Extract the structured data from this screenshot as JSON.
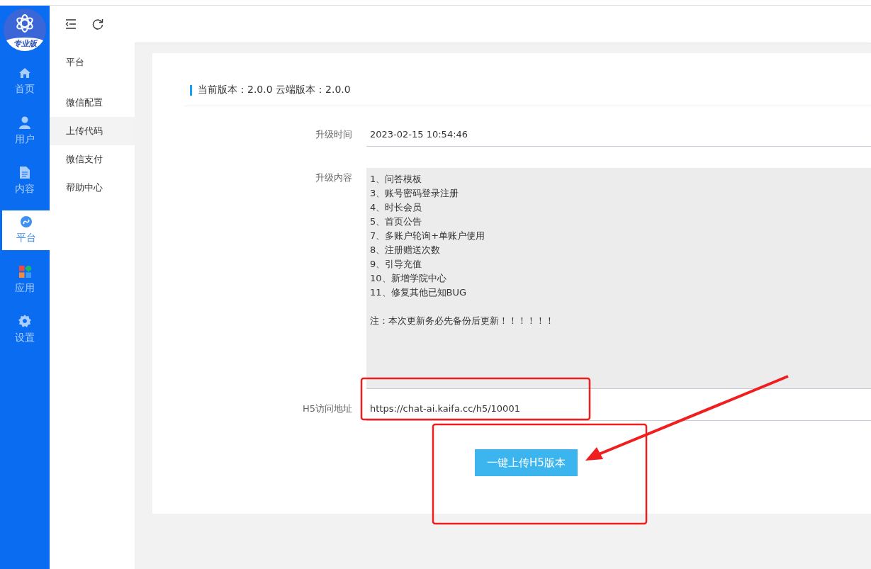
{
  "logo": {
    "badge": "专业版"
  },
  "rail": {
    "items": [
      {
        "label": "首页",
        "selected": false
      },
      {
        "label": "用户",
        "selected": false
      },
      {
        "label": "内容",
        "selected": false
      },
      {
        "label": "平台",
        "selected": true
      },
      {
        "label": "应用",
        "selected": false
      },
      {
        "label": "设置",
        "selected": false
      }
    ]
  },
  "submenu": {
    "title": "平台",
    "items": [
      {
        "label": "微信配置",
        "selected": false
      },
      {
        "label": "上传代码",
        "selected": true
      },
      {
        "label": "微信支付",
        "selected": false
      },
      {
        "label": "帮助中心",
        "selected": false
      }
    ]
  },
  "card": {
    "title": "当前版本：2.0.0 云端版本：2.0.0",
    "fields": [
      {
        "kind": "line",
        "label": "升级时间",
        "value": "2023-02-15 10:54:46"
      },
      {
        "kind": "area",
        "label": "升级内容",
        "value": "1、问答模板\n3、账号密码登录注册\n4、时长会员\n5、首页公告\n7、多账户轮询+单账户使用\n8、注册赠送次数\n9、引导充值\n10、新增学院中心\n11、修复其他已知BUG\n\n注：本次更新务必先备份后更新！！！！！！"
      },
      {
        "kind": "line",
        "label": "H5访问地址",
        "value": "https://chat-ai.kaifa.cc/h5/10001"
      }
    ],
    "button": "一键上传H5版本"
  }
}
